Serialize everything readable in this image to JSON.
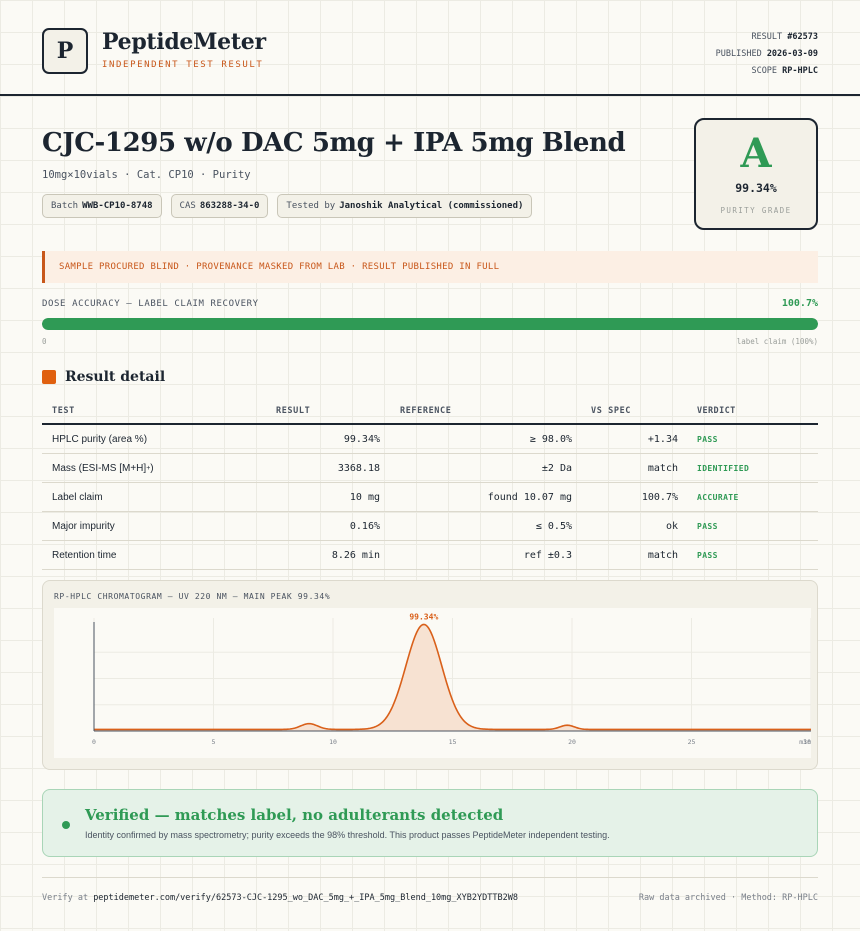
{
  "header": {
    "logo_letter": "P",
    "brand": "PeptideMeter",
    "brand_sub": "INDEPENDENT TEST RESULT",
    "meta": [
      {
        "label": "RESULT",
        "value": "#62573"
      },
      {
        "label": "PUBLISHED",
        "value": "2026-03-09"
      },
      {
        "label": "SCOPE",
        "value": "RP-HPLC"
      }
    ]
  },
  "product": {
    "title": "CJC-1295 w/o DAC 5mg + IPA 5mg Blend",
    "subtitle": "10mg×10vials · Cat. CP10 · Purity",
    "chips": [
      {
        "label": "Batch",
        "value": "WWB-CP10-8748"
      },
      {
        "label": "CAS",
        "value": "863288-34-0"
      },
      {
        "label": "Tested by",
        "value": "Janoshik Analytical (commissioned)"
      }
    ]
  },
  "grade": {
    "letter": "A",
    "value": "99.34%",
    "label": "PURITY GRADE",
    "color": "#2f9a55"
  },
  "banner": {
    "text": "SAMPLE PROCURED BLIND · PROVENANCE MASKED FROM LAB · RESULT PUBLISHED IN FULL"
  },
  "dose": {
    "label": "DOSE ACCURACY — LABEL CLAIM RECOVERY",
    "value_text": "100.7%",
    "fill_fraction": 1.0,
    "min_label": "0",
    "max_label": "label claim (100%)"
  },
  "section": {
    "title": "Result detail"
  },
  "table": {
    "headers": [
      "TEST",
      "RESULT",
      "REFERENCE",
      "VS SPEC",
      "VERDICT"
    ],
    "rows": [
      {
        "test": "HPLC purity (area %)",
        "sup": "",
        "result": "99.34%",
        "reference": "≥ 98.0%",
        "spec": "+1.34",
        "verdict": "PASS"
      },
      {
        "test": "Mass (ESI-MS [M+H]",
        "sup": "+",
        "test_tail": ")",
        "result": "3368.18",
        "reference": "±2 Da",
        "spec": "match",
        "verdict": "IDENTIFIED"
      },
      {
        "test": "Label claim",
        "sup": "",
        "result": "10 mg",
        "reference": "found 10.07 mg",
        "spec": "100.7%",
        "verdict": "ACCURATE"
      },
      {
        "test": "Major impurity",
        "sup": "",
        "result": "0.16%",
        "reference": "≤ 0.5%",
        "spec": "ok",
        "verdict": "PASS"
      },
      {
        "test": "Retention time",
        "sup": "",
        "result": "8.26 min",
        "reference": "ref ±0.3",
        "spec": "match",
        "verdict": "PASS"
      }
    ]
  },
  "chromatogram": {
    "title": "RP-HPLC CHROMATOGRAM — UV 220 NM — MAIN PEAK 99.34%",
    "peak_label": "99.34%",
    "x_ticks": [
      "0",
      "5",
      "10",
      "15",
      "20",
      "25",
      "30"
    ],
    "x_unit": "min",
    "x_max": 30,
    "baseline": 0.015,
    "peaks": [
      {
        "x": 9.0,
        "height": 0.055,
        "width": 0.35
      },
      {
        "x": 13.8,
        "height": 1.0,
        "width": 0.75
      },
      {
        "x": 19.8,
        "height": 0.04,
        "width": 0.3
      }
    ],
    "line_color": "#d9601a",
    "fill_color": "#f7e2d2"
  },
  "verified": {
    "title": "Verified — matches label, no adulterants detected",
    "subtitle": "Identity confirmed by mass spectrometry; purity exceeds the 98% threshold. This product passes PeptideMeter independent testing."
  },
  "footer": {
    "verify_prefix": "Verify at",
    "verify_url": "peptidemeter.com/verify/62573-CJC-1295_wo_DAC_5mg_+_IPA_5mg_Blend_10mg_XYB2YDTTB2W8",
    "right": "Raw data archived · Method: RP-HPLC"
  }
}
